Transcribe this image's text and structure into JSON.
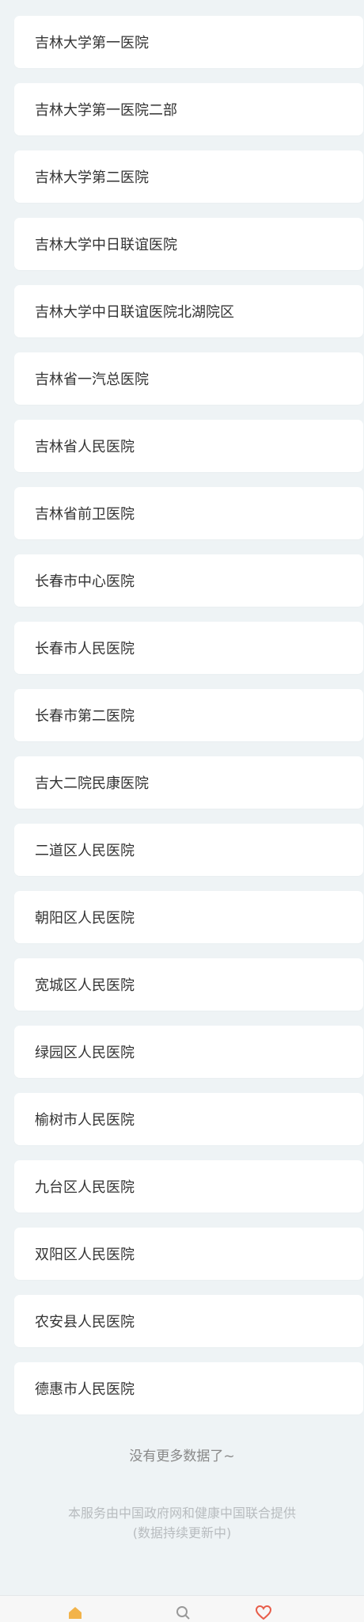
{
  "hospitals": [
    "吉林大学第一医院",
    "吉林大学第一医院二部",
    "吉林大学第二医院",
    "吉林大学中日联谊医院",
    "吉林大学中日联谊医院北湖院区",
    "吉林省一汽总医院",
    "吉林省人民医院",
    "吉林省前卫医院",
    "长春市中心医院",
    "长春市人民医院",
    "长春市第二医院",
    "吉大二院民康医院",
    "二道区人民医院",
    "朝阳区人民医院",
    "宽城区人民医院",
    "绿园区人民医院",
    "榆树市人民医院",
    "九台区人民医院",
    "双阳区人民医院",
    "农安县人民医院",
    "德惠市人民医院"
  ],
  "no_more": "没有更多数据了~",
  "footer": {
    "line1": "本服务由中国政府网和健康中国联合提供",
    "line2": "(数据持续更新中)"
  },
  "tabbar": {
    "tab1_label": "",
    "tab2_label": "",
    "tab3_label": "",
    "tab1_icon": "home-icon",
    "tab2_icon": "search-icon",
    "tab3_icon": "heart-icon",
    "accent": "#e85d4a"
  }
}
